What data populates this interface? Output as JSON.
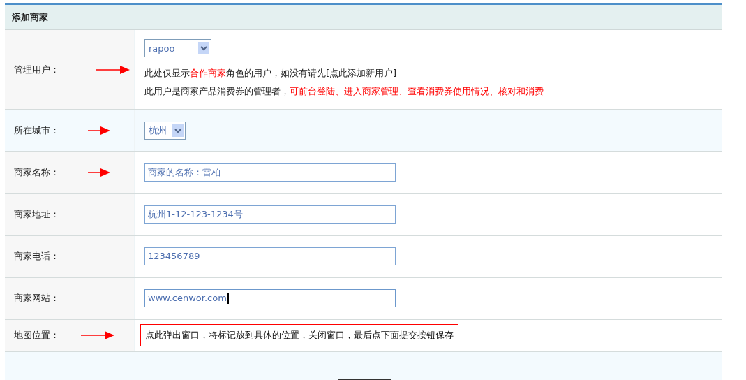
{
  "form": {
    "title": "添加商家",
    "rows": [
      {
        "label": "管理用户：",
        "arrow": true,
        "kind": "select",
        "value": "rapoo",
        "notes": [
          [
            {
              "text": "此处仅显示",
              "highlight": false
            },
            {
              "text": "合作商家",
              "highlight": true
            },
            {
              "text": "角色的用户，如没有请先[点此添加新用户]",
              "highlight": false
            }
          ],
          [
            {
              "text": "此用户是商家产品消费券的管理者，",
              "highlight": false
            },
            {
              "text": "可前台登陆、进入商家管理、查看消费券使用情况、核对和消费",
              "highlight": true
            }
          ]
        ]
      },
      {
        "label": "所在城市：",
        "arrow": true,
        "kind": "select",
        "value": "杭州"
      },
      {
        "label": "商家名称：",
        "arrow": true,
        "kind": "input",
        "value": "商家的名称：雷柏",
        "focused": false
      },
      {
        "label": "商家地址：",
        "arrow": false,
        "kind": "input",
        "value": "杭州1-12-123-1234号",
        "focused": false
      },
      {
        "label": "商家电话：",
        "arrow": false,
        "kind": "input",
        "value": "123456789",
        "focused": false
      },
      {
        "label": "商家网站：",
        "arrow": false,
        "kind": "input",
        "value": "www.cenwor.com",
        "focused": true
      },
      {
        "label": "地图位置：",
        "arrow": true,
        "kind": "note",
        "value": "点此弹出窗口，将标记放到具体的位置，关闭窗口，最后点下面提交按钮保存"
      }
    ]
  }
}
